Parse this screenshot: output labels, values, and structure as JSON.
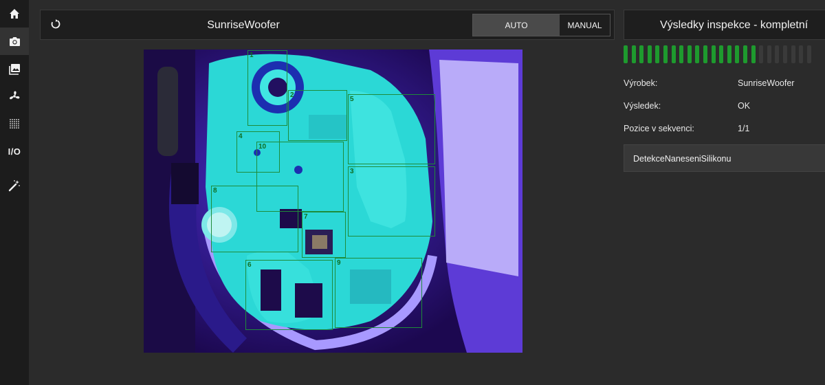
{
  "sidebar": {
    "items": [
      {
        "name": "home",
        "icon": "home-icon"
      },
      {
        "name": "camera",
        "icon": "camera-icon",
        "active": true
      },
      {
        "name": "gallery",
        "icon": "image-gallery-icon"
      },
      {
        "name": "fan",
        "icon": "fan-icon"
      },
      {
        "name": "grid",
        "icon": "dot-grid-icon"
      },
      {
        "name": "io",
        "label": "I/O"
      },
      {
        "name": "magic",
        "icon": "magic-wand-icon"
      }
    ]
  },
  "header": {
    "product_name": "SunriseWoofer",
    "mode": {
      "auto_label": "AUTO",
      "manual_label": "MANUAL",
      "selected": "AUTO"
    },
    "reload_icon": "refresh-icon"
  },
  "camera_view": {
    "rois": [
      {
        "label": "1"
      },
      {
        "label": "2"
      },
      {
        "label": "5"
      },
      {
        "label": "4"
      },
      {
        "label": "10"
      },
      {
        "label": "3"
      },
      {
        "label": "8"
      },
      {
        "label": "7"
      },
      {
        "label": "6"
      },
      {
        "label": "9"
      }
    ]
  },
  "results": {
    "title": "Výsledky inspekce - kompletní",
    "progress": {
      "done": 17,
      "total": 24,
      "done_color": "#1e9a2e",
      "pending_color": "#3a3a3a"
    },
    "product_label": "Výrobek:",
    "product_value": "SunriseWoofer",
    "result_label": "Výsledek:",
    "result_value": "OK",
    "position_label": "Pozice v sekvenci:",
    "position_value": "1/1",
    "detections": [
      "DetekceNaneseniSilikonu"
    ]
  }
}
